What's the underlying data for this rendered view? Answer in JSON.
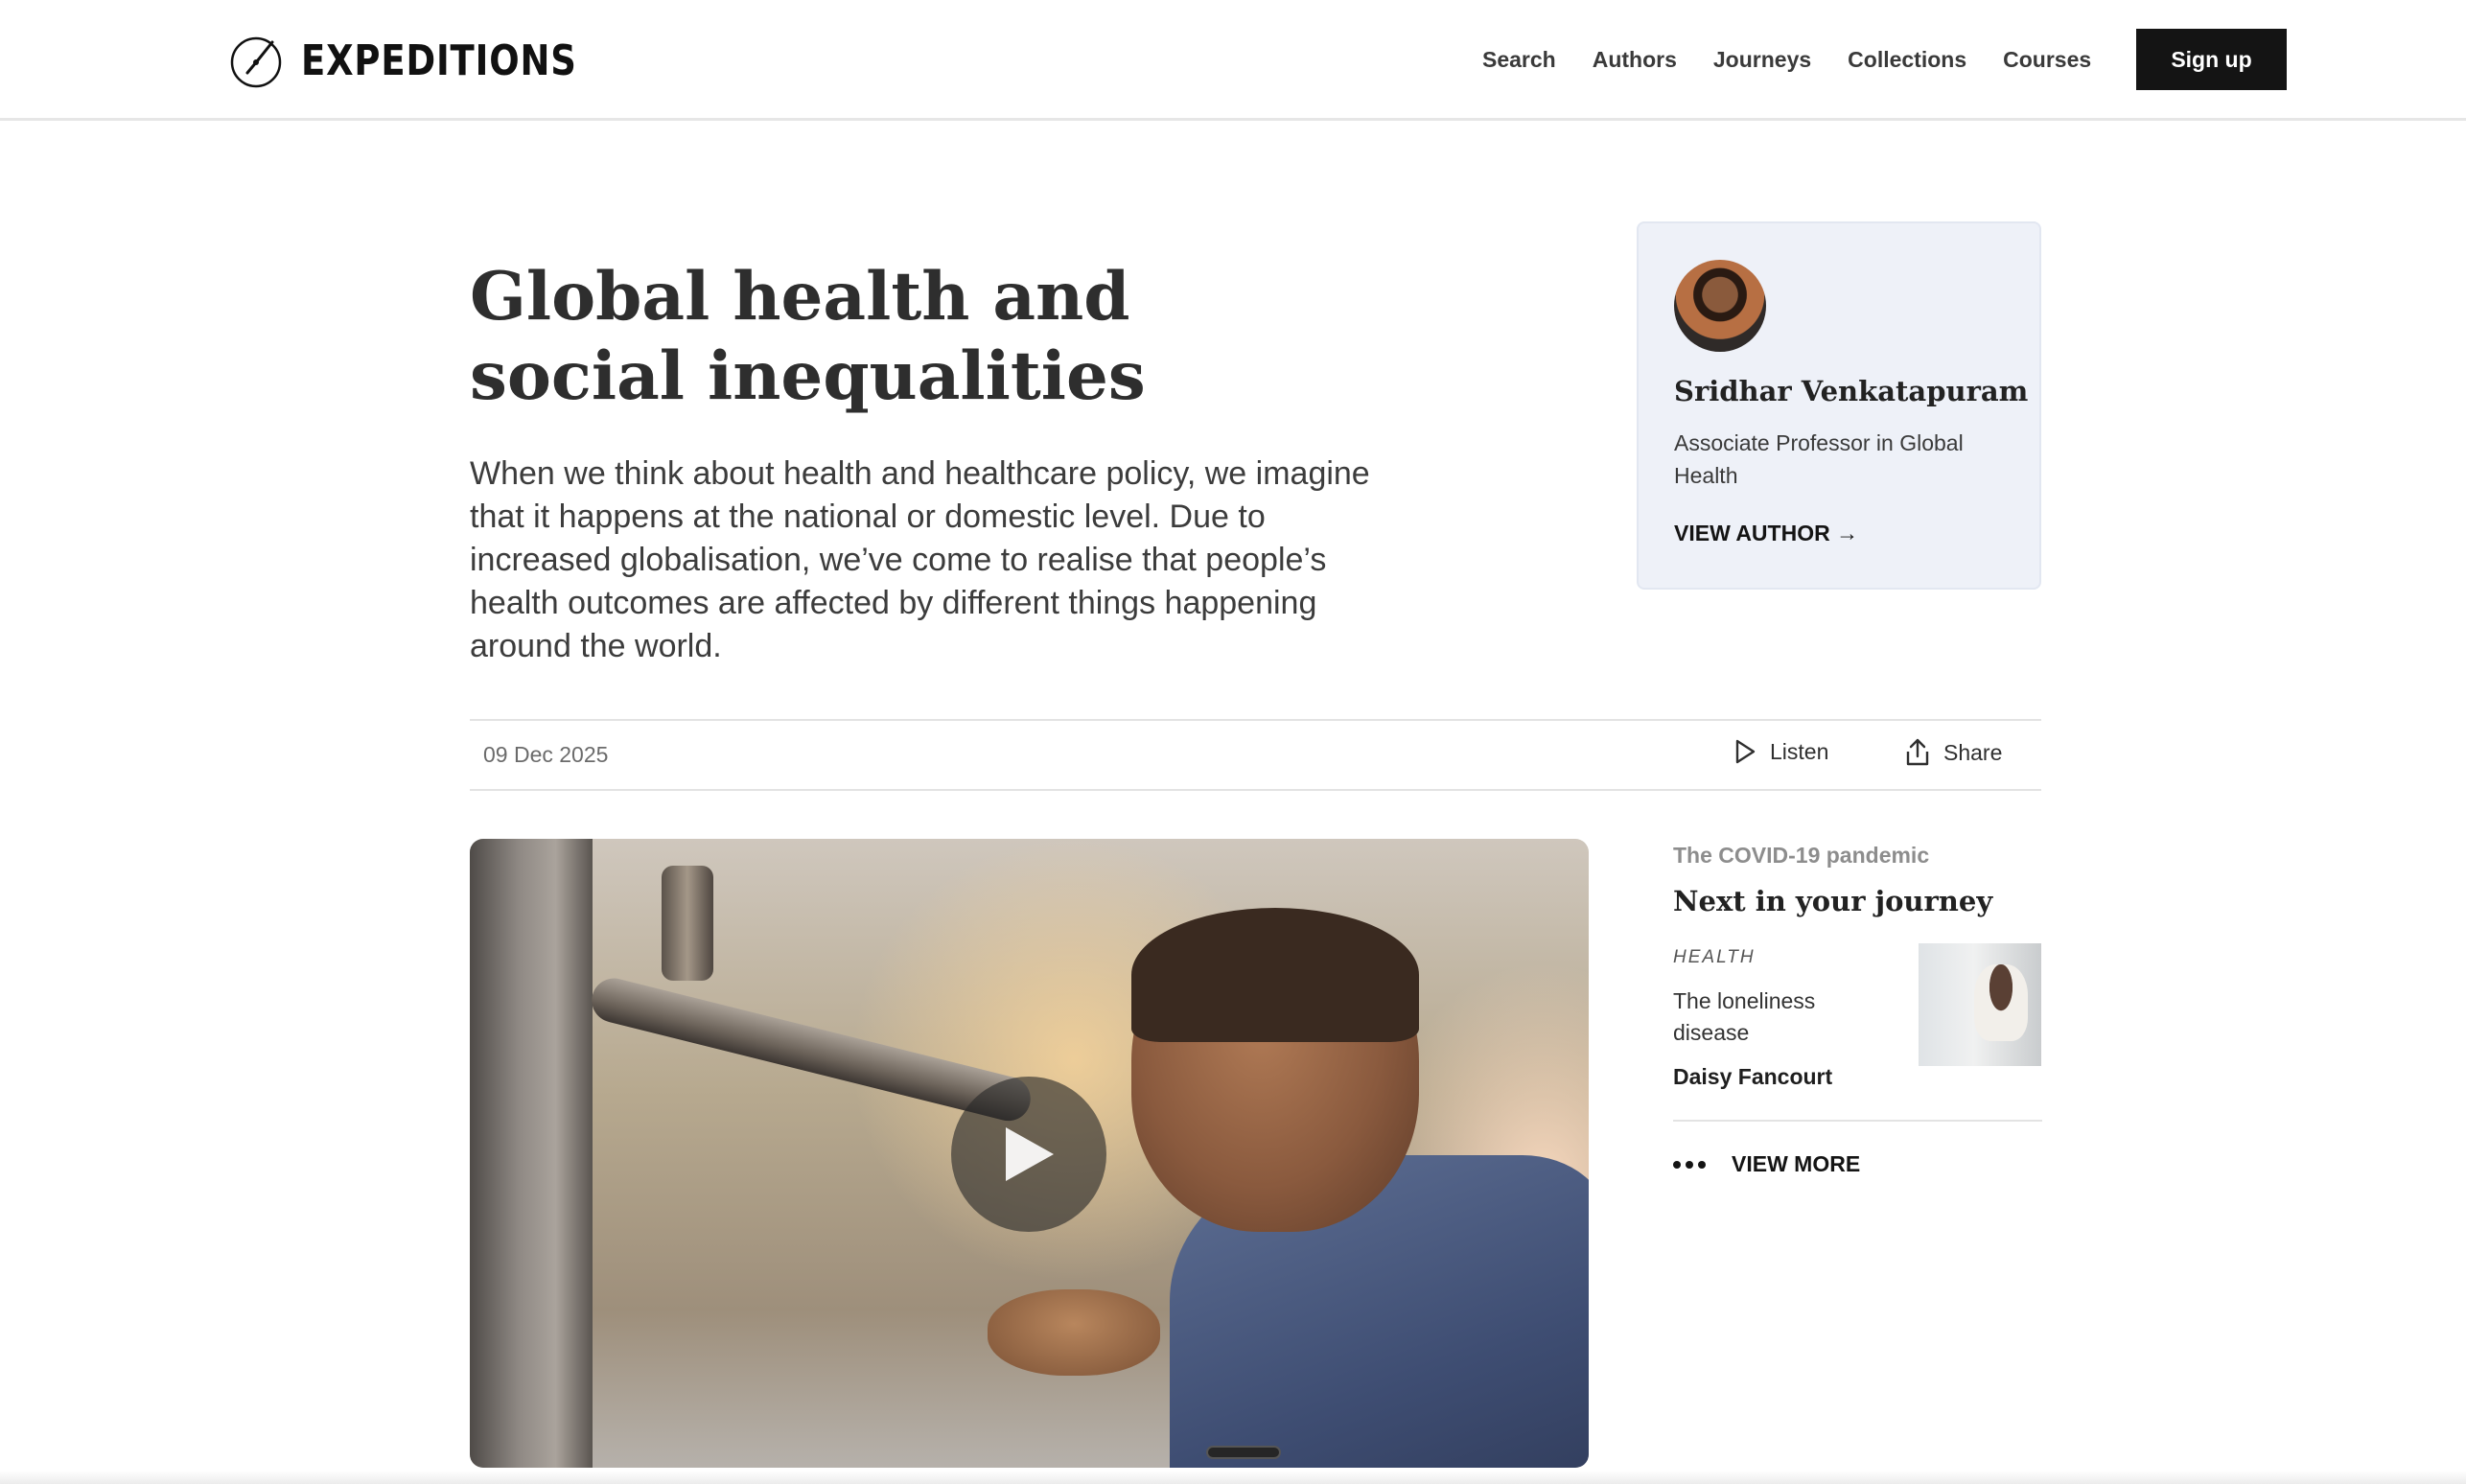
{
  "header": {
    "logo_text": "EXPEDITIONS",
    "nav": [
      "Search",
      "Authors",
      "Journeys",
      "Collections",
      "Courses"
    ],
    "signup_label": "Sign up"
  },
  "article": {
    "title": "Global health and social inequalities",
    "lede": "When we think about health and healthcare policy, we imagine that it happens at the national or domestic level. Due to increased globalisation, we’ve come to realise that people’s health outcomes are affected by different things happening around the world.",
    "date": "09 Dec 2025",
    "listen_label": "Listen",
    "share_label": "Share"
  },
  "author": {
    "name": "Sridhar Venkatapuram",
    "role": "Associate Professor in Global Health",
    "link_label": "VIEW AUTHOR →"
  },
  "journey": {
    "kicker": "The COVID-19 pandemic",
    "title": "Next in your journey",
    "card": {
      "tag": "HEALTH",
      "title": "The loneliness disease",
      "author": "Daisy Fancourt"
    },
    "view_more": "VIEW MORE"
  },
  "icons": {
    "logo": "compass-logo-icon",
    "listen": "play-outline-icon",
    "share": "share-upload-icon",
    "video_play": "play-icon",
    "more": "more-dots-icon"
  },
  "colors": {
    "primary_button": "#141414",
    "author_card_bg": "#eef1f8"
  }
}
